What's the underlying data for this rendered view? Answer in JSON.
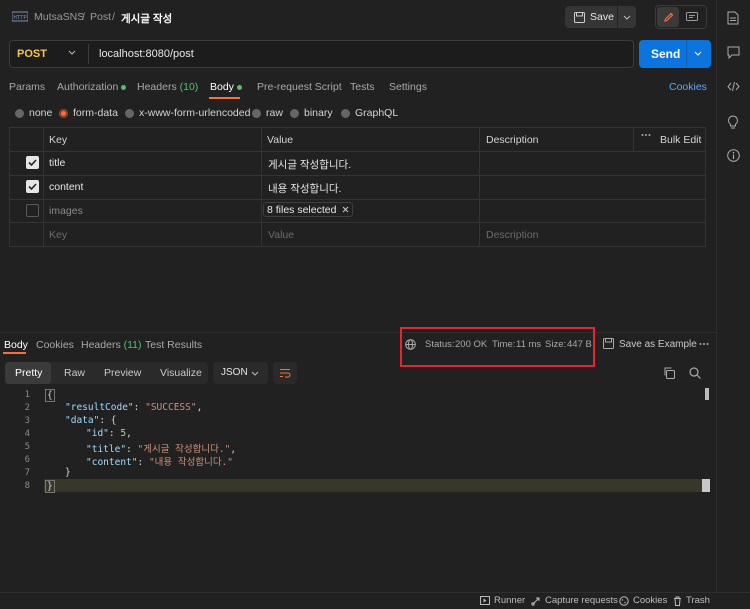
{
  "breadcrumb": {
    "workspace": "MutsaSNS",
    "sep1": "/",
    "collection": "Post",
    "sep2": "/",
    "request": "게시글 작성"
  },
  "toolbar": {
    "save_label": "Save"
  },
  "request": {
    "method": "POST",
    "url": "localhost:8080/post",
    "send_label": "Send"
  },
  "request_tabs": [
    "Params",
    "Authorization",
    "Headers",
    "Body",
    "Pre-request Script",
    "Tests",
    "Settings"
  ],
  "headers_count": "(10)",
  "cookies_label": "Cookies",
  "body_types": [
    "none",
    "form-data",
    "x-www-form-urlencoded",
    "raw",
    "binary",
    "GraphQL"
  ],
  "table": {
    "headers": {
      "key": "Key",
      "value": "Value",
      "description": "Description",
      "bulk_edit": "Bulk Edit"
    },
    "rows": [
      {
        "key": "title",
        "value": "게시글 작성합니다.",
        "checked": true
      },
      {
        "key": "content",
        "value": "내용 작성합니다.",
        "checked": true
      },
      {
        "key": "images",
        "value": "8 files selected",
        "checked": false
      }
    ],
    "placeholder": {
      "key": "Key",
      "value": "Value",
      "description": "Description"
    }
  },
  "response": {
    "tabs": [
      "Body",
      "Cookies",
      "Headers",
      "Test Results"
    ],
    "headers_count": "(11)",
    "status_label": "Status:",
    "status_value": "200 OK",
    "time_label": "Time:",
    "time_value": "11 ms",
    "size_label": "Size:",
    "size_value": "447 B",
    "save_example": "Save as Example",
    "view_tabs": [
      "Pretty",
      "Raw",
      "Preview",
      "Visualize"
    ],
    "format": "JSON",
    "line_numbers": [
      "1",
      "2",
      "3",
      "4",
      "5",
      "6",
      "7",
      "8"
    ],
    "json": {
      "resultCode_key": "\"resultCode\"",
      "resultCode_val": "\"SUCCESS\"",
      "data_key": "\"data\"",
      "id_key": "\"id\"",
      "id_val": "5",
      "title_key": "\"title\"",
      "title_val": "\"게시글 작성합니다.\"",
      "content_key": "\"content\"",
      "content_val": "\"내용 작성합니다.\""
    }
  },
  "footer": {
    "runner": "Runner",
    "capture": "Capture requests",
    "cookies": "Cookies",
    "trash": "Trash"
  },
  "colors": {
    "accent": "#ff6c37",
    "send": "#0b74de",
    "status_ok": "#4fc26b",
    "method": "#f2c94c",
    "highlight": "#e5262e"
  }
}
